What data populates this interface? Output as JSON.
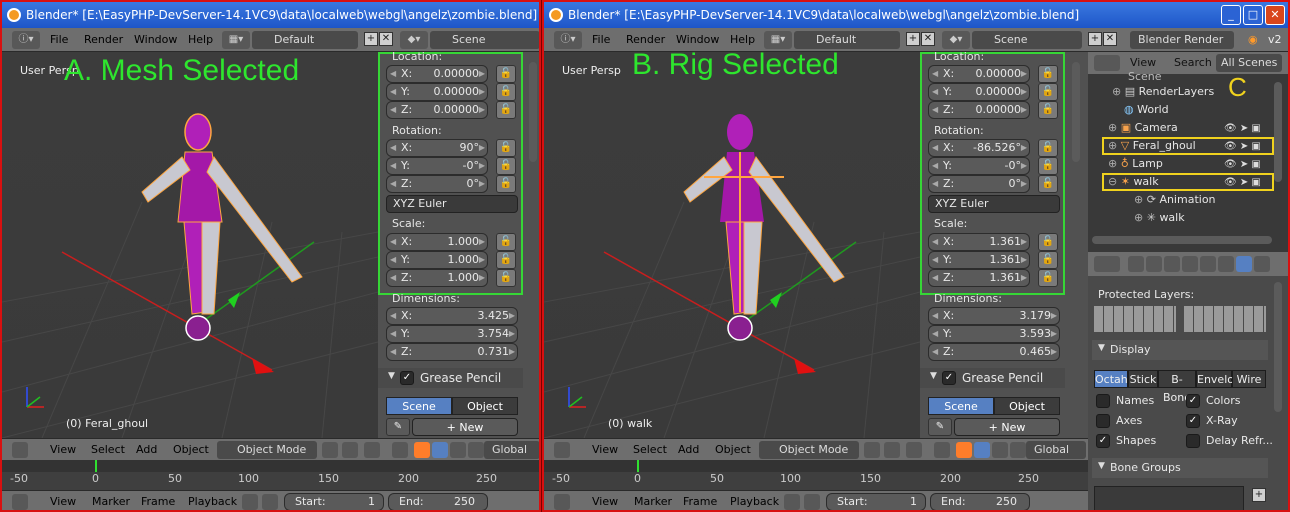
{
  "window": {
    "title": "Blender* [E:\\EasyPHP-DevServer-14.1VC9\\data\\localweb\\webgl\\angelz\\zombie.blend]",
    "controls": [
      "_",
      "□",
      "✕"
    ]
  },
  "menu": {
    "items": [
      "File",
      "Render",
      "Window",
      "Help"
    ],
    "layout": "Default",
    "scene": "Scene",
    "engine": "Blender Render",
    "version": "v2"
  },
  "panel_a": {
    "label": "A. Mesh Selected",
    "view_name": "User Persp",
    "object_name": "(0) Feral_ghoul",
    "location": {
      "title": "Location:",
      "x": "0.00000",
      "y": "0.00000",
      "z": "0.00000"
    },
    "rotation": {
      "title": "Rotation:",
      "x": "90°",
      "y": "-0°",
      "z": "0°",
      "mode": "XYZ Euler"
    },
    "scale": {
      "title": "Scale:",
      "x": "1.000",
      "y": "1.000",
      "z": "1.000"
    },
    "dimensions": {
      "title": "Dimensions:",
      "x": "3.425",
      "y": "3.754",
      "z": "0.731"
    }
  },
  "panel_b": {
    "label": "B. Rig Selected",
    "view_name": "User Persp",
    "object_name": "(0) walk",
    "location": {
      "title": "Location:",
      "x": "0.00000",
      "y": "0.00000",
      "z": "0.00000"
    },
    "rotation": {
      "title": "Rotation:",
      "x": "-86.526°",
      "y": "-0°",
      "z": "0°",
      "mode": "XYZ Euler"
    },
    "scale": {
      "title": "Scale:",
      "x": "1.361",
      "y": "1.361",
      "z": "1.361"
    },
    "dimensions": {
      "title": "Dimensions:",
      "x": "3.179",
      "y": "3.593",
      "z": "0.465"
    }
  },
  "axis_labels": {
    "x": "X:",
    "y": "Y:",
    "z": "Z:"
  },
  "grease_pencil": {
    "title": "Grease Pencil",
    "scene": "Scene",
    "object": "Object",
    "new": "New"
  },
  "view_header": {
    "menus": [
      "View",
      "Select",
      "Add",
      "Object"
    ],
    "mode": "Object Mode",
    "orientation": "Global"
  },
  "timeline": {
    "ticks": [
      "-50",
      "0",
      "50",
      "100",
      "150",
      "200",
      "250"
    ],
    "menus": [
      "View",
      "Marker",
      "Frame",
      "Playback"
    ],
    "start_label": "Start:",
    "start": "1",
    "end_label": "End:",
    "end": "250"
  },
  "outliner": {
    "menus": [
      "View",
      "Search"
    ],
    "filter": "All Scenes",
    "marker": "C",
    "rows": [
      "Scene",
      "RenderLayers",
      "World",
      "Camera",
      "Feral_ghoul",
      "Lamp",
      "walk",
      "Animation",
      "walk"
    ]
  },
  "properties": {
    "protected_layers": "Protected Layers:",
    "display_title": "Display",
    "display_modes": [
      "Octah",
      "Stick",
      "B-Bone",
      "Envelo",
      "Wire"
    ],
    "options": [
      {
        "label": "Names",
        "checked": false
      },
      {
        "label": "Colors",
        "checked": true
      },
      {
        "label": "Axes",
        "checked": false
      },
      {
        "label": "X-Ray",
        "checked": true
      },
      {
        "label": "Shapes",
        "checked": true
      },
      {
        "label": "Delay Refr...",
        "checked": false
      }
    ],
    "bone_groups": "Bone Groups"
  },
  "colors": {
    "accent_green": "#36d636",
    "highlight_yellow": "#f0d21e",
    "frame_red": "#d81010",
    "selected_blue": "#5680c2"
  }
}
